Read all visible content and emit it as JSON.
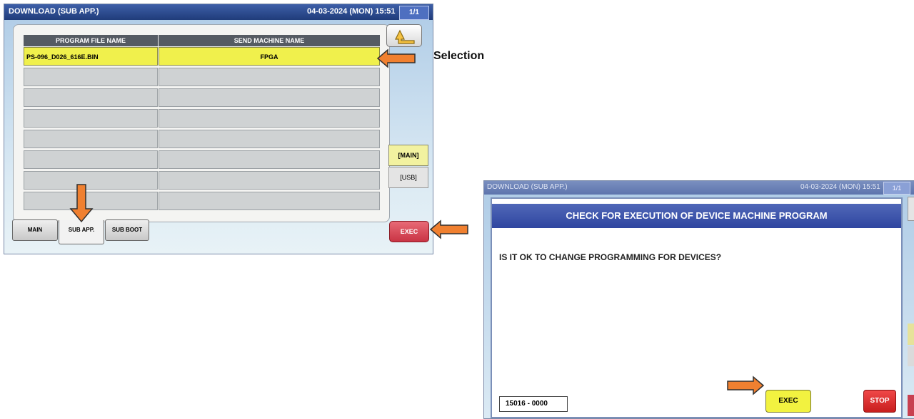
{
  "screen1": {
    "title": "DOWNLOAD (SUB APP.)",
    "datetime": "04-03-2024 (MON)  15:51",
    "page": "1/1",
    "table": {
      "headers": [
        "PROGRAM FILE NAME",
        "SEND MACHINE NAME"
      ],
      "rows": [
        [
          "PS-096_D026_616E.BIN",
          "FPGA"
        ],
        [
          "",
          ""
        ],
        [
          "",
          ""
        ],
        [
          "",
          ""
        ],
        [
          "",
          ""
        ],
        [
          "",
          ""
        ],
        [
          "",
          ""
        ],
        [
          "",
          ""
        ]
      ]
    },
    "side_buttons": {
      "main": "[MAIN]",
      "usb": "[USB]"
    },
    "exec_label": "EXEC",
    "tabs": [
      "MAIN",
      "SUB APP.",
      "SUB BOOT"
    ],
    "active_tab": "SUB APP."
  },
  "annotation": {
    "selection_label": "Selection"
  },
  "screen2": {
    "title": "DOWNLOAD (SUB APP.)",
    "datetime": "04-03-2024 (MON)  15:51",
    "page": "1/1",
    "dialog_title": "CHECK FOR EXECUTION OF DEVICE MACHINE PROGRAM",
    "message": "IS IT OK TO CHANGE PROGRAMMING FOR DEVICES?",
    "code": "15016 - 0000",
    "exec_label": "EXEC",
    "stop_label": "STOP"
  },
  "colors": {
    "selected_row": "#f0f04c",
    "arrow": "#f08030",
    "exec_red": "#c93444",
    "stop_red": "#d42020",
    "dialog_header": "#2f46a0"
  },
  "icons": [
    "return-arrow-icon",
    "orange-arrow-icon"
  ]
}
